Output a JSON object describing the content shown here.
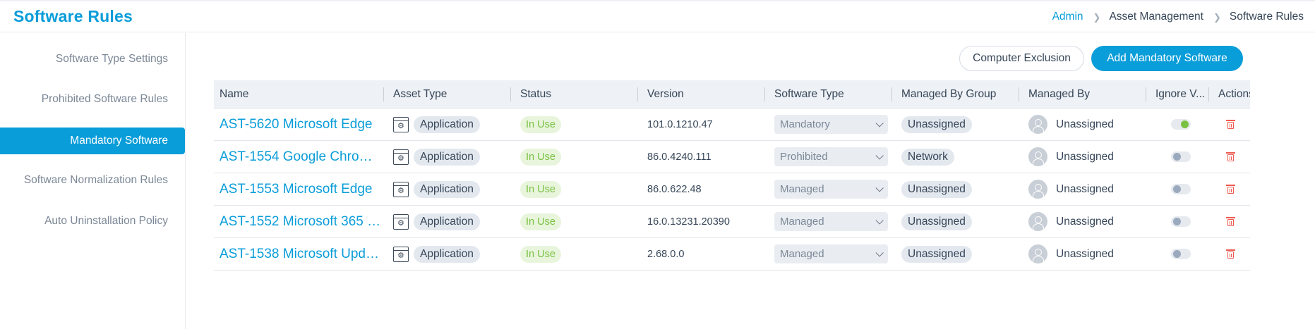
{
  "header": {
    "title": "Software Rules",
    "breadcrumb": [
      "Admin",
      "Asset Management",
      "Software Rules"
    ]
  },
  "sidebar": {
    "items": [
      {
        "label": "Software Type Settings",
        "active": false
      },
      {
        "label": "Prohibited Software Rules",
        "active": false
      },
      {
        "label": "Mandatory Software",
        "active": true
      },
      {
        "label": "Software Normalization Rules",
        "active": false
      },
      {
        "label": "Auto Uninstallation Policy",
        "active": false
      }
    ]
  },
  "toolbar": {
    "exclusion_label": "Computer Exclusion",
    "add_label": "Add Mandatory Software"
  },
  "table": {
    "columns": [
      "Name",
      "Asset Type",
      "Status",
      "Version",
      "Software Type",
      "Managed By Group",
      "Managed By",
      "Ignore V...",
      "Actions"
    ],
    "rows": [
      {
        "name": "AST-5620 Microsoft Edge",
        "asset_type": "Application",
        "status": "In Use",
        "version": "101.0.1210.47",
        "software_type": "Mandatory",
        "group": "Unassigned",
        "managed_by": "Unassigned",
        "ignore": true
      },
      {
        "name": "AST-1554 Google Chro…",
        "asset_type": "Application",
        "status": "In Use",
        "version": "86.0.4240.111",
        "software_type": "Prohibited",
        "group": "Network",
        "managed_by": "Unassigned",
        "ignore": false
      },
      {
        "name": "AST-1553 Microsoft Edge",
        "asset_type": "Application",
        "status": "In Use",
        "version": "86.0.622.48",
        "software_type": "Managed",
        "group": "Unassigned",
        "managed_by": "Unassigned",
        "ignore": false
      },
      {
        "name": "AST-1552 Microsoft 365 …",
        "asset_type": "Application",
        "status": "In Use",
        "version": "16.0.13231.20390",
        "software_type": "Managed",
        "group": "Unassigned",
        "managed_by": "Unassigned",
        "ignore": false
      },
      {
        "name": "AST-1538 Microsoft Upd…",
        "asset_type": "Application",
        "status": "In Use",
        "version": "2.68.0.0",
        "software_type": "Managed",
        "group": "Unassigned",
        "managed_by": "Unassigned",
        "ignore": false
      }
    ]
  },
  "colors": {
    "accent": "#099dd9",
    "status_green": "#7ac143",
    "delete_red": "#f05a50"
  }
}
